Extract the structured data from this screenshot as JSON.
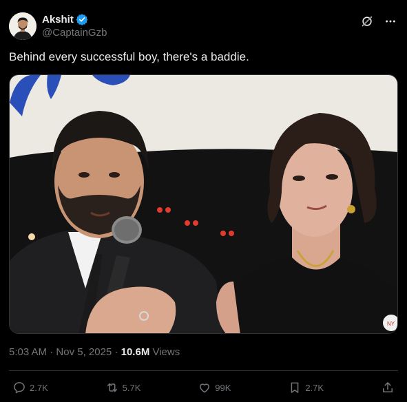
{
  "author": {
    "display_name": "Akshit",
    "handle": "@CaptainGzb",
    "verified": true
  },
  "tweet": {
    "text": "Behind every successful boy, there's a baddie."
  },
  "meta": {
    "time": "5:03 AM",
    "separator": " · ",
    "date": "Nov 5, 2025",
    "dot": " · ",
    "views_count": "10.6M",
    "views_label": " Views"
  },
  "actions": {
    "replies": "2.7K",
    "reposts": "5.7K",
    "likes": "99K",
    "bookmarks": "2.7K"
  },
  "colors": {
    "background": "#000000",
    "text": "#e7e9ea",
    "secondary": "#71767b",
    "verified": "#1d9bf0",
    "divider": "#2f3336"
  },
  "icons": {
    "header": [
      "grok-icon",
      "more-icon"
    ],
    "actions": [
      "reply-icon",
      "repost-icon",
      "like-icon",
      "bookmark-icon",
      "share-icon"
    ]
  }
}
